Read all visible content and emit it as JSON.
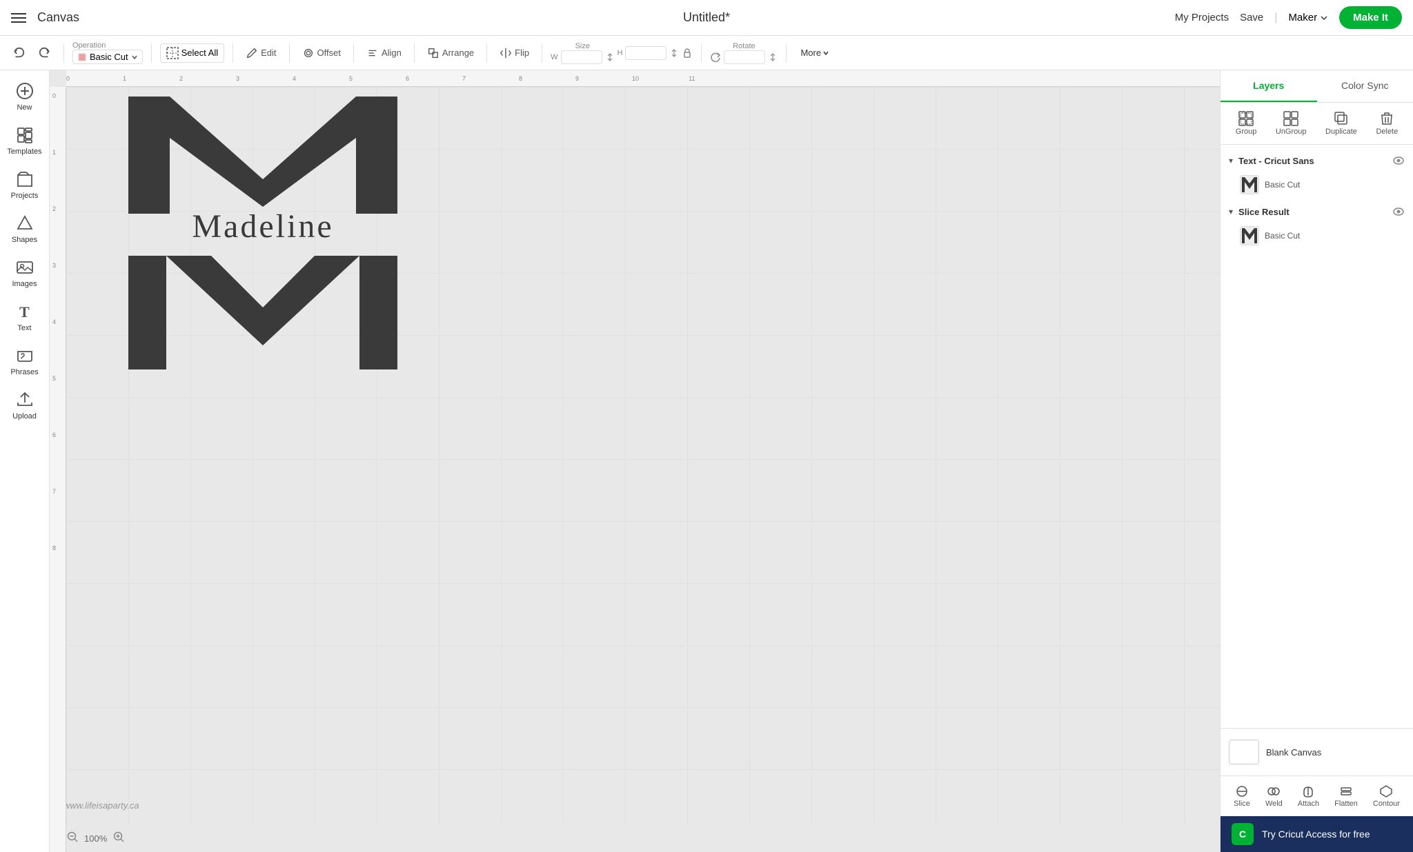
{
  "nav": {
    "hamburger_label": "Menu",
    "logo": "Canvas",
    "title": "Untitled*",
    "my_projects": "My Projects",
    "save": "Save",
    "divider": "|",
    "maker": "Maker",
    "make_it": "Make It"
  },
  "toolbar": {
    "undo_label": "Undo",
    "redo_label": "Redo",
    "operation_label": "Operation",
    "operation_value": "Basic Cut",
    "select_all": "Select All",
    "edit": "Edit",
    "offset": "Offset",
    "align": "Align",
    "arrange": "Arrange",
    "flip": "Flip",
    "size": "Size",
    "w_label": "W",
    "h_label": "H",
    "rotate": "Rotate",
    "more": "More"
  },
  "sidebar": {
    "items": [
      {
        "id": "new",
        "label": "New",
        "icon": "new-icon"
      },
      {
        "id": "templates",
        "label": "Templates",
        "icon": "templates-icon"
      },
      {
        "id": "projects",
        "label": "Projects",
        "icon": "projects-icon"
      },
      {
        "id": "shapes",
        "label": "Shapes",
        "icon": "shapes-icon"
      },
      {
        "id": "images",
        "label": "Images",
        "icon": "images-icon"
      },
      {
        "id": "text",
        "label": "Text",
        "icon": "text-icon"
      },
      {
        "id": "phrases",
        "label": "Phrases",
        "icon": "phrases-icon"
      },
      {
        "id": "upload",
        "label": "Upload",
        "icon": "upload-icon"
      }
    ]
  },
  "canvas": {
    "zoom": "100%",
    "watermark": "www.lifeisaparty.ca",
    "text_content": "Madeline",
    "ruler_marks": [
      "0",
      "1",
      "2",
      "3",
      "4",
      "5",
      "6",
      "7",
      "8",
      "9",
      "10",
      "11"
    ]
  },
  "right_panel": {
    "tabs": [
      {
        "id": "layers",
        "label": "Layers",
        "active": true
      },
      {
        "id": "color-sync",
        "label": "Color Sync",
        "active": false
      }
    ],
    "actions": [
      {
        "id": "group",
        "label": "Group"
      },
      {
        "id": "ungroup",
        "label": "UnGroup"
      },
      {
        "id": "duplicate",
        "label": "Duplicate"
      },
      {
        "id": "delete",
        "label": "Delete"
      }
    ],
    "layers": [
      {
        "id": "text-cricut-sans",
        "title": "Text - Cricut Sans",
        "expanded": true,
        "items": [
          {
            "id": "text-basic-cut",
            "thumb": "M",
            "name": "Basic Cut"
          }
        ]
      },
      {
        "id": "slice-result",
        "title": "Slice Result",
        "expanded": true,
        "items": [
          {
            "id": "slice-basic-cut",
            "thumb": "M",
            "name": "Basic Cut"
          }
        ]
      }
    ],
    "blank_canvas_label": "Blank Canvas",
    "bottom_tools": [
      {
        "id": "slice",
        "label": "Slice"
      },
      {
        "id": "weld",
        "label": "Weld"
      },
      {
        "id": "attach",
        "label": "Attach"
      },
      {
        "id": "flatten",
        "label": "Flatten"
      },
      {
        "id": "contour",
        "label": "Contour"
      }
    ]
  },
  "promo": {
    "logo": "C",
    "text": "Try Cricut Access for free"
  }
}
